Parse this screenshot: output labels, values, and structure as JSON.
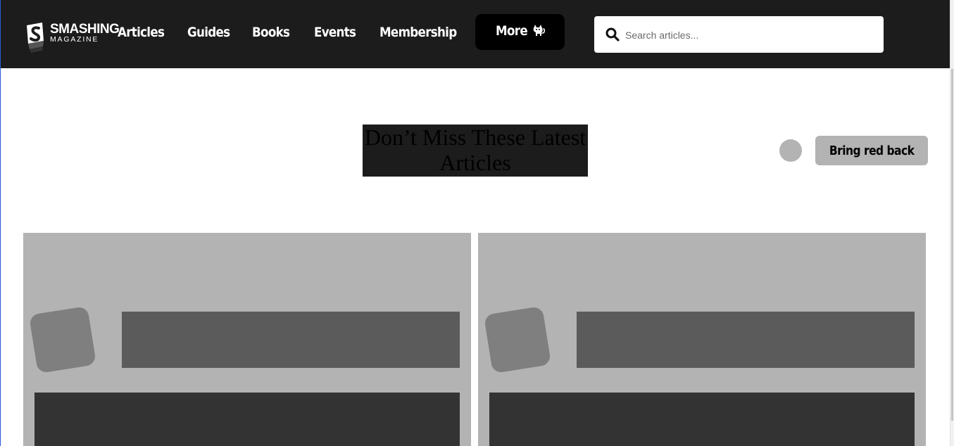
{
  "brand": {
    "name": "SMASHING",
    "sub": "MAGAZINE"
  },
  "nav": {
    "items": [
      {
        "label": "Articles"
      },
      {
        "label": "Guides"
      },
      {
        "label": "Books"
      },
      {
        "label": "Events"
      },
      {
        "label": "Membership"
      }
    ],
    "more_label": "More"
  },
  "search": {
    "placeholder": "Search articles..."
  },
  "section": {
    "title": "Don’t Miss These Latest Articles",
    "toggle_button_label": "Bring red back"
  },
  "colors": {
    "header_bg": "#1c1c1c",
    "placeholder_gray": "#b3b3b3",
    "dark_gray": "#333333",
    "mid_gray": "#5b5b5b"
  },
  "icons": [
    "smashing-logo-icon",
    "cat-icon",
    "search-icon"
  ]
}
